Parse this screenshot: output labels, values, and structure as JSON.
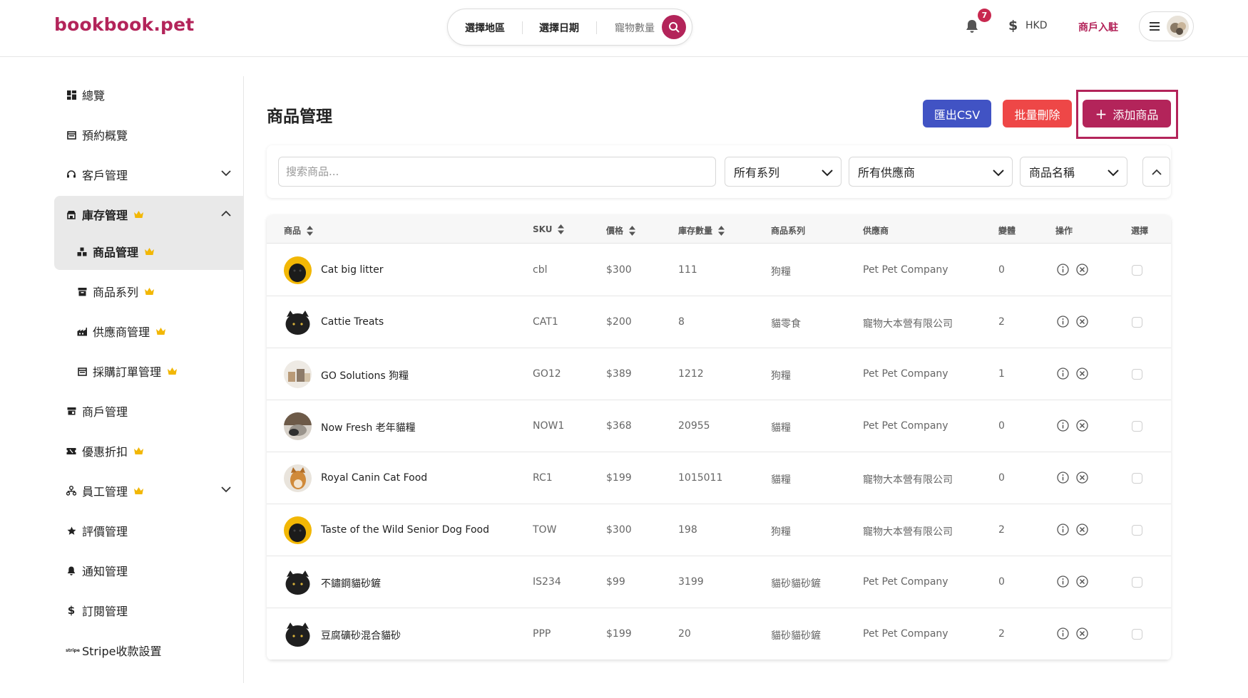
{
  "header": {
    "logo": "bookbook.pet",
    "search": {
      "region": "選擇地區",
      "date": "選擇日期",
      "pets": "寵物數量"
    },
    "notification_count": "7",
    "currency": "HKD",
    "merchant_link": "商戶入駐"
  },
  "sidebar": {
    "items": [
      {
        "label": "總覽",
        "icon": "dashboard-icon"
      },
      {
        "label": "預約概覽",
        "icon": "calendar-icon"
      },
      {
        "label": "客戶管理",
        "icon": "headset-icon"
      },
      {
        "label": "庫存管理",
        "icon": "store-icon"
      },
      {
        "label": "商品管理",
        "icon": "boxes-icon"
      },
      {
        "label": "商品系列",
        "icon": "archive-icon"
      },
      {
        "label": "供應商管理",
        "icon": "factory-icon"
      },
      {
        "label": "採購訂單管理",
        "icon": "calendar-icon"
      },
      {
        "label": "商戶管理",
        "icon": "shop-icon"
      },
      {
        "label": "優惠折扣",
        "icon": "ticket-icon"
      },
      {
        "label": "員工管理",
        "icon": "org-icon"
      },
      {
        "label": "評價管理",
        "icon": "star-icon"
      },
      {
        "label": "通知管理",
        "icon": "bell-icon"
      },
      {
        "label": "訂閱管理",
        "icon": "dollar-icon"
      },
      {
        "label": "Stripe收款設置",
        "icon": "stripe-icon"
      }
    ]
  },
  "main": {
    "title": "商品管理",
    "export_label": "匯出CSV",
    "bulk_delete_label": "批量刪除",
    "add_label": "添加商品",
    "filters": {
      "search_placeholder": "搜索商品...",
      "series": "所有系列",
      "supplier": "所有供應商",
      "sort_by": "商品名稱"
    },
    "columns": [
      "商品",
      "SKU",
      "價格",
      "庫存數量",
      "商品系列",
      "供應商",
      "變體",
      "操作",
      "選擇"
    ],
    "rows": [
      {
        "name": "Cat big litter",
        "sku": "cbl",
        "price": "$300",
        "stock": "111",
        "series": "狗糧",
        "supplier": "Pet Pet Company",
        "variants": "0"
      },
      {
        "name": "Cattie Treats",
        "sku": "CAT1",
        "price": "$200",
        "stock": "8",
        "series": "貓零食",
        "supplier": "寵物大本營有限公司",
        "variants": "2"
      },
      {
        "name": "GO Solutions 狗糧",
        "sku": "GO12",
        "price": "$389",
        "stock": "1212",
        "series": "狗糧",
        "supplier": "Pet Pet Company",
        "variants": "1"
      },
      {
        "name": "Now Fresh 老年貓糧",
        "sku": "NOW1",
        "price": "$368",
        "stock": "20955",
        "series": "貓糧",
        "supplier": "Pet Pet Company",
        "variants": "0"
      },
      {
        "name": "Royal Canin Cat Food",
        "sku": "RC1",
        "price": "$199",
        "stock": "1015011",
        "series": "貓糧",
        "supplier": "寵物大本營有限公司",
        "variants": "0"
      },
      {
        "name": "Taste of the Wild Senior Dog Food",
        "sku": "TOW",
        "price": "$300",
        "stock": "198",
        "series": "狗糧",
        "supplier": "寵物大本營有限公司",
        "variants": "2"
      },
      {
        "name": "不鏽鋼貓砂鏟",
        "sku": "IS234",
        "price": "$99",
        "stock": "3199",
        "series": "貓砂貓砂鏟",
        "supplier": "Pet Pet Company",
        "variants": "0"
      },
      {
        "name": "豆腐礦砂混合貓砂",
        "sku": "PPP",
        "price": "$199",
        "stock": "20",
        "series": "貓砂貓砂鏟",
        "supplier": "Pet Pet Company",
        "variants": "2"
      }
    ]
  },
  "colors": {
    "brand": "#b3245a",
    "export": "#4153c4",
    "delete": "#ee4747",
    "crown": "#f2b705"
  }
}
